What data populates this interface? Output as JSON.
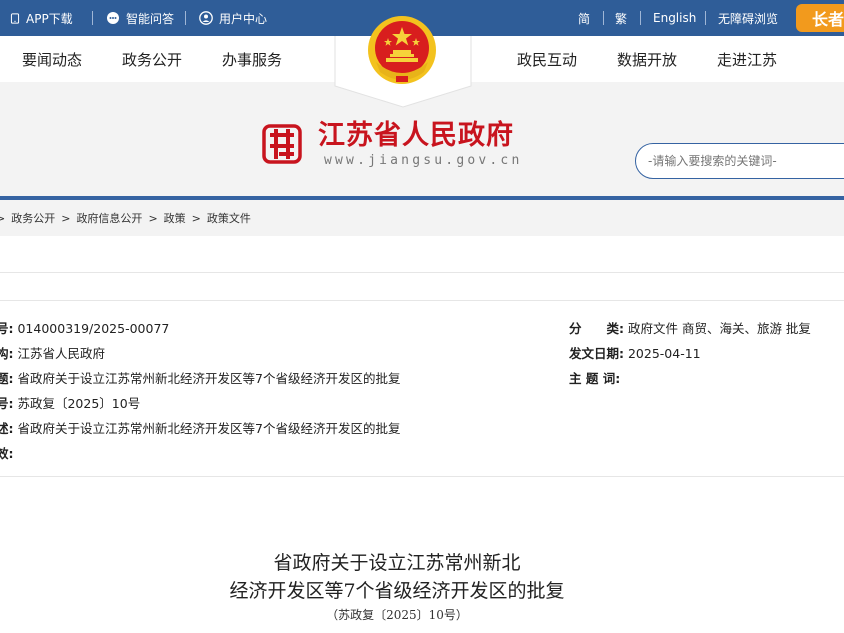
{
  "topbar": {
    "app_download": "APP下载",
    "smart_qa": "智能问答",
    "user_center": "用户中心",
    "simplified": "简",
    "traditional": "繁",
    "english": "English",
    "accessible": "无障碍浏览",
    "elder_mode": "长者"
  },
  "nav": {
    "left": [
      "要闻动态",
      "政务公开",
      "办事服务"
    ],
    "right": [
      "政民互动",
      "数据开放",
      "走进江苏"
    ]
  },
  "banner": {
    "site_title": "江苏省人民政府",
    "site_url": "www.jiangsu.gov.cn",
    "search_placeholder": "-请输入要搜索的关键词-"
  },
  "breadcrumb": [
    "政务公开",
    "政府信息公开",
    "政策",
    "政策文件"
  ],
  "breadcrumb_sep": ">",
  "colors": {
    "header_blue": "#2f5d98",
    "accent_red": "#c8141e",
    "elder_orange": "#f29a1d"
  },
  "meta_left": [
    {
      "label": "号:",
      "value": "014000319/2025-00077"
    },
    {
      "label": "构:",
      "value": "江苏省人民政府"
    },
    {
      "label": "题:",
      "value": "省政府关于设立江苏常州新北经济开发区等7个省级经济开发区的批复"
    },
    {
      "label": "号:",
      "value": "苏政复〔2025〕10号"
    },
    {
      "label": "述:",
      "value": "省政府关于设立江苏常州新北经济开发区等7个省级经济开发区的批复"
    },
    {
      "label": "效:",
      "value": ""
    }
  ],
  "meta_right": [
    {
      "label": "分　　类:",
      "value": "政府文件 商贸、海关、旅游 批复"
    },
    {
      "label": "发文日期:",
      "value": "2025-04-11"
    },
    {
      "label": "主 题 词:",
      "value": ""
    }
  ],
  "document": {
    "title_line1": "省政府关于设立江苏常州新北",
    "title_line2": "经济开发区等7个省级经济开发区的批复",
    "doc_number": "（苏政复〔2025〕10号）"
  }
}
